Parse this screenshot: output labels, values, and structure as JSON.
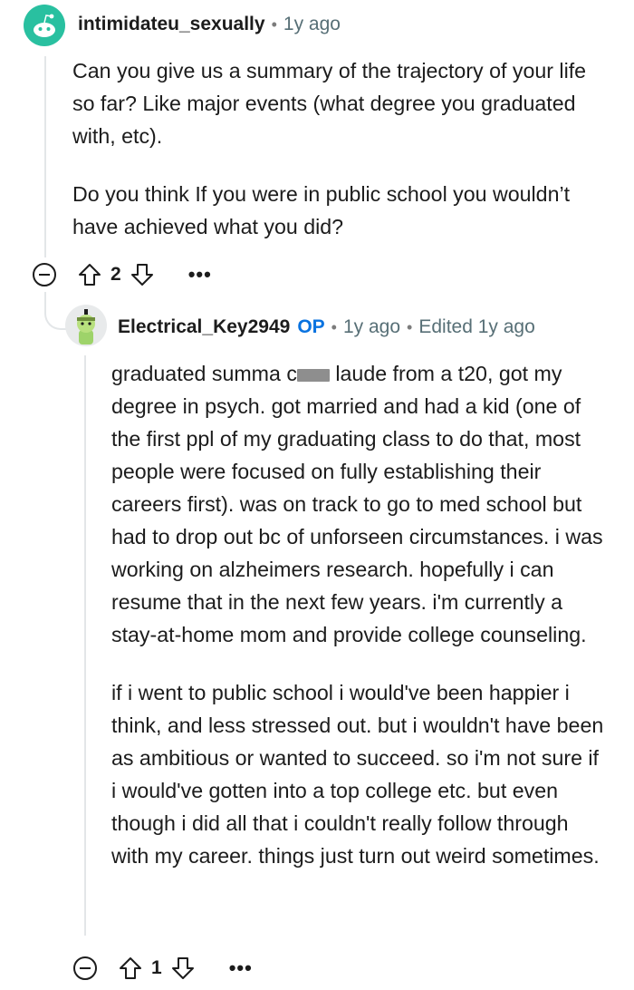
{
  "comment1": {
    "author": "intimidateu_sexually",
    "time": "1y ago",
    "body_p1": "Can you give us a summary of the trajectory of your life so far? Like major events (what degree you graduated with, etc).",
    "body_p2": "Do you think If you were in public school you wouldn’t have achieved what you did?",
    "votes": "2",
    "more": "•••",
    "avatar_color": "#29c0a0"
  },
  "comment2": {
    "author": "Electrical_Key2949",
    "op_badge": "OP",
    "time": "1y ago",
    "edited": "Edited 1y ago",
    "body_p1_before": "graduated summa c",
    "body_p1_after": " laude from a t20, got my degree in psych. got married and had a kid (one of the first ppl of my graduating class to do that, most people were focused on fully establishing their careers first). was on track to go to med school but had to drop out bc of unforseen circumstances. i was working on alzheimers research. hopefully i can resume that in the next few years. i'm currently a stay-at-home mom and provide college counseling.",
    "body_p2": "if i went to public school i would've been happier i think, and less stressed out. but i wouldn't have been as ambitious or wanted to succeed. so i'm not sure if i would've gotten into a top college etc. but even though i did all that i couldn't really follow through with my career. things just turn out weird sometimes.",
    "votes": "1",
    "more": "•••",
    "avatar_color": "#9ed36a"
  }
}
